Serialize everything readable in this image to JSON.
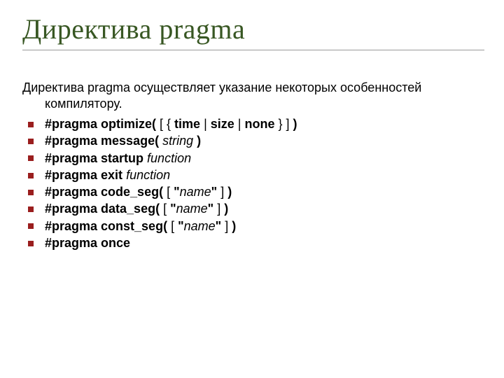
{
  "title": "Директива pragma",
  "intro_line1": "Директива pragma осуществляет указание некоторых особенностей",
  "intro_line2": "компилятору.",
  "items": [
    {
      "p1": "#pragma optimize( ",
      "p2": "[ { ",
      "p3": "time ",
      "p4": "| ",
      "p5": "size ",
      "p6": "| ",
      "p7": "none ",
      "p8": "} ] ",
      "p9": ")"
    },
    {
      "p1": "#pragma message( ",
      "p2": "string",
      "p3": " )"
    },
    {
      "p1": "#pragma startup ",
      "p2": "function"
    },
    {
      "p1": "#pragma exit ",
      "p2": "function"
    },
    {
      "p1": "#pragma code_seg( ",
      "p2": "[ ",
      "p3": "\"",
      "p4": "name",
      "p5": "\" ",
      "p6": "] ",
      "p7": ")"
    },
    {
      "p1": "#pragma data_seg( ",
      "p2": "[ ",
      "p3": "\"",
      "p4": "name",
      "p5": "\" ",
      "p6": "] ",
      "p7": ")"
    },
    {
      "p1": "#pragma const_seg( ",
      "p2": "[ ",
      "p3": "\"",
      "p4": "name",
      "p5": "\" ",
      "p6": "] ",
      "p7": ")"
    },
    {
      "p1": "#pragma once"
    }
  ]
}
